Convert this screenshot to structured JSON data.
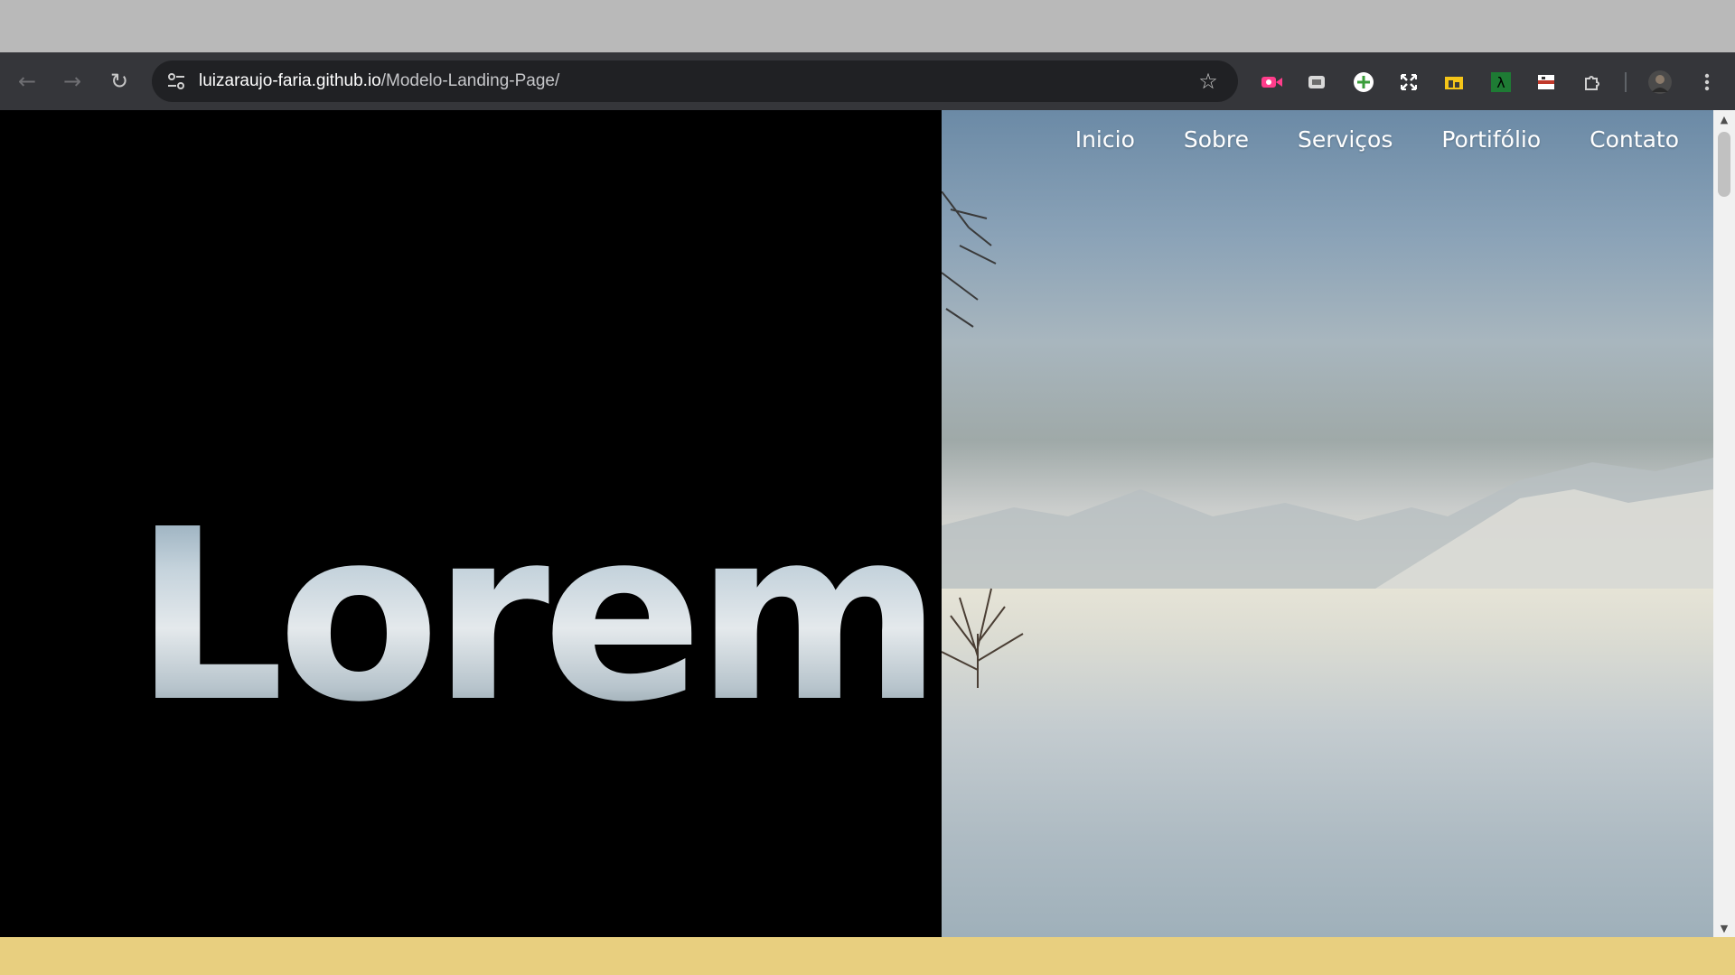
{
  "browser": {
    "url_host": "luizaraujo-faria.github.io",
    "url_path": "/Modelo-Landing-Page/",
    "back_icon": "arrow-left-icon",
    "forward_icon": "arrow-right-icon",
    "reload_icon": "reload-icon",
    "star_icon": "star-icon",
    "extensions": [
      "screen-recorder-icon",
      "shield-extension-icon",
      "add-circle-icon",
      "expand-arrows-icon",
      "folder-extension-icon",
      "lambda-extension-icon",
      "video-extension-icon",
      "puzzle-icon"
    ]
  },
  "page": {
    "hero_word": "Lorem",
    "nav": [
      "Inicio",
      "Sobre",
      "Serviços",
      "Portifólio",
      "Contato"
    ]
  },
  "colors": {
    "toolbar": "#35363a",
    "omnibox": "#202124",
    "left_panel": "#000000",
    "bottom_strip": "#e8cf7f"
  }
}
